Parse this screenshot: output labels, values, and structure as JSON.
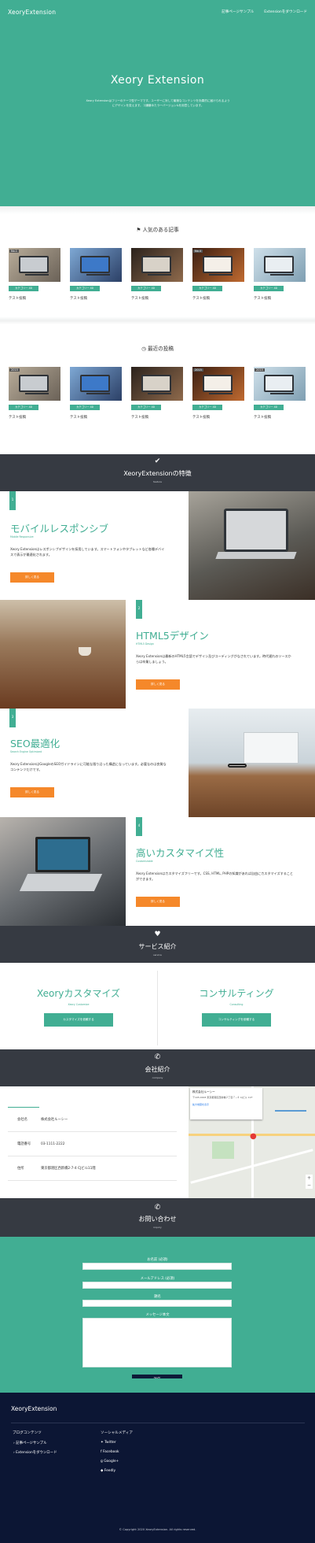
{
  "header": {
    "logo": "XeoryExtension",
    "nav": [
      "記事ページサンプル",
      "Extensionをダウンロード"
    ]
  },
  "hero": {
    "title": "Xeory Extension",
    "description": "Xeory Extensionはフリーのテーマ型デーマです。ユーザーに対して最適なコンテンツを効果的に届けられるようにデザインを変えます。コ嫌嫌ゆたラーバージョン&を用意しています。"
  },
  "popular": {
    "heading": "人気のある記事",
    "cards": [
      {
        "num": "No.1",
        "category": "カテゴリー 40",
        "title": "テスト投稿"
      },
      {
        "num": "",
        "category": "カテゴリー 40",
        "title": "テスト投稿"
      },
      {
        "num": "",
        "category": "カテゴリー 40",
        "title": "テスト投稿"
      },
      {
        "num": "No.4",
        "category": "カテゴリー 40",
        "title": "テスト投稿"
      },
      {
        "num": "",
        "category": "カテゴリー 40",
        "title": "テスト投稿"
      }
    ]
  },
  "recent": {
    "heading": "最近の投稿",
    "cards": [
      {
        "num": "2015",
        "category": "カテゴリー 40",
        "title": "テスト投稿"
      },
      {
        "num": "",
        "category": "カテゴリー 40",
        "title": "テスト投稿"
      },
      {
        "num": "",
        "category": "カテゴリー 40",
        "title": "テスト投稿"
      },
      {
        "num": "2015",
        "category": "カテゴリー 40",
        "title": "テスト投稿"
      },
      {
        "num": "2015",
        "category": "カテゴリー 40",
        "title": "テスト投稿"
      }
    ]
  },
  "features_band": {
    "title": "XeoryExtensionの特徴",
    "sub": "feature"
  },
  "features": [
    {
      "num": "1",
      "title": "モバイルレスポンシブ",
      "sub": "Mobile Responsive",
      "desc": "Xeory Extensionはレスポンシブデザインを採用しています。スマートフォンやタブレットなど各種デバイスで表示が最適化されます。",
      "button": "詳しく見る"
    },
    {
      "num": "2",
      "title": "HTML5デザイン",
      "sub": "HTML5 Design",
      "desc": "Xeory Extensionは最新のHTML5言語でデザイン及びコーディングがなされています。時代遅れのソースからは卒業しましょう。",
      "button": "詳しく見る"
    },
    {
      "num": "3",
      "title": "SEO最適化",
      "sub": "Search Engine Optimized",
      "desc": "Xeory ExtensionはGoogleのSEOガイドラインに可能な限り沿った構造になっています。必要なのは良質なコンテンツだけです。",
      "button": "詳しく見る"
    },
    {
      "num": "4",
      "title": "高いカスタマイズ性",
      "sub": "Customizable",
      "desc": "Xeory Extensionはカスタマイズフリーです。CSS, HTML, PHPの知識があれば自由にカスタマイズすることができます。",
      "button": "詳しく見る"
    }
  ],
  "services_band": {
    "title": "サービス紹介",
    "sub": "service"
  },
  "services": [
    {
      "title": "Xeoryカスタマイズ",
      "sub": "Xeory Customize",
      "button": "カスタマイズを依頼する"
    },
    {
      "title": "コンサルティング",
      "sub": "Consulting",
      "button": "コンサルティングを依頼する"
    }
  ],
  "company_band": {
    "title": "会社紹介",
    "sub": "company"
  },
  "company": [
    {
      "k": "会社名",
      "v": "株式会社ルーシー"
    },
    {
      "k": "電話番号",
      "v": "03-1111-2222"
    },
    {
      "k": "住所",
      "v": "東京都港区西新橋2-7-4 CJビル11階"
    }
  ],
  "map": {
    "title": "株式会社ルーシー",
    "address": "〒105-0003 東京都港区西新橋２丁目７−４ CJビル 11F",
    "link": "拡大地図を表示"
  },
  "contact_band": {
    "title": "お問い合わせ",
    "sub": "inquiry"
  },
  "contact": {
    "fields": [
      "お名前 (必須)",
      "メールアドレス (必須)",
      "題名",
      "メッセージ本文"
    ],
    "submit": "送信"
  },
  "footer": {
    "logo": "XeoryExtension",
    "col1_title": "ブログコンテンツ",
    "col1": [
      "記事ページサンプル",
      "Extensionをダウンロード"
    ],
    "col2_title": "ソーシャルメディア",
    "col2": [
      "Twitter",
      "Facebook",
      "Google+",
      "Feedly"
    ],
    "copyright": "© Copyright 2020 XeoryExtension. All rights reserved."
  },
  "colors": {
    "accent": "#41ae93",
    "dark": "#363a42",
    "footer": "#0c1634",
    "button": "#f5882a"
  }
}
